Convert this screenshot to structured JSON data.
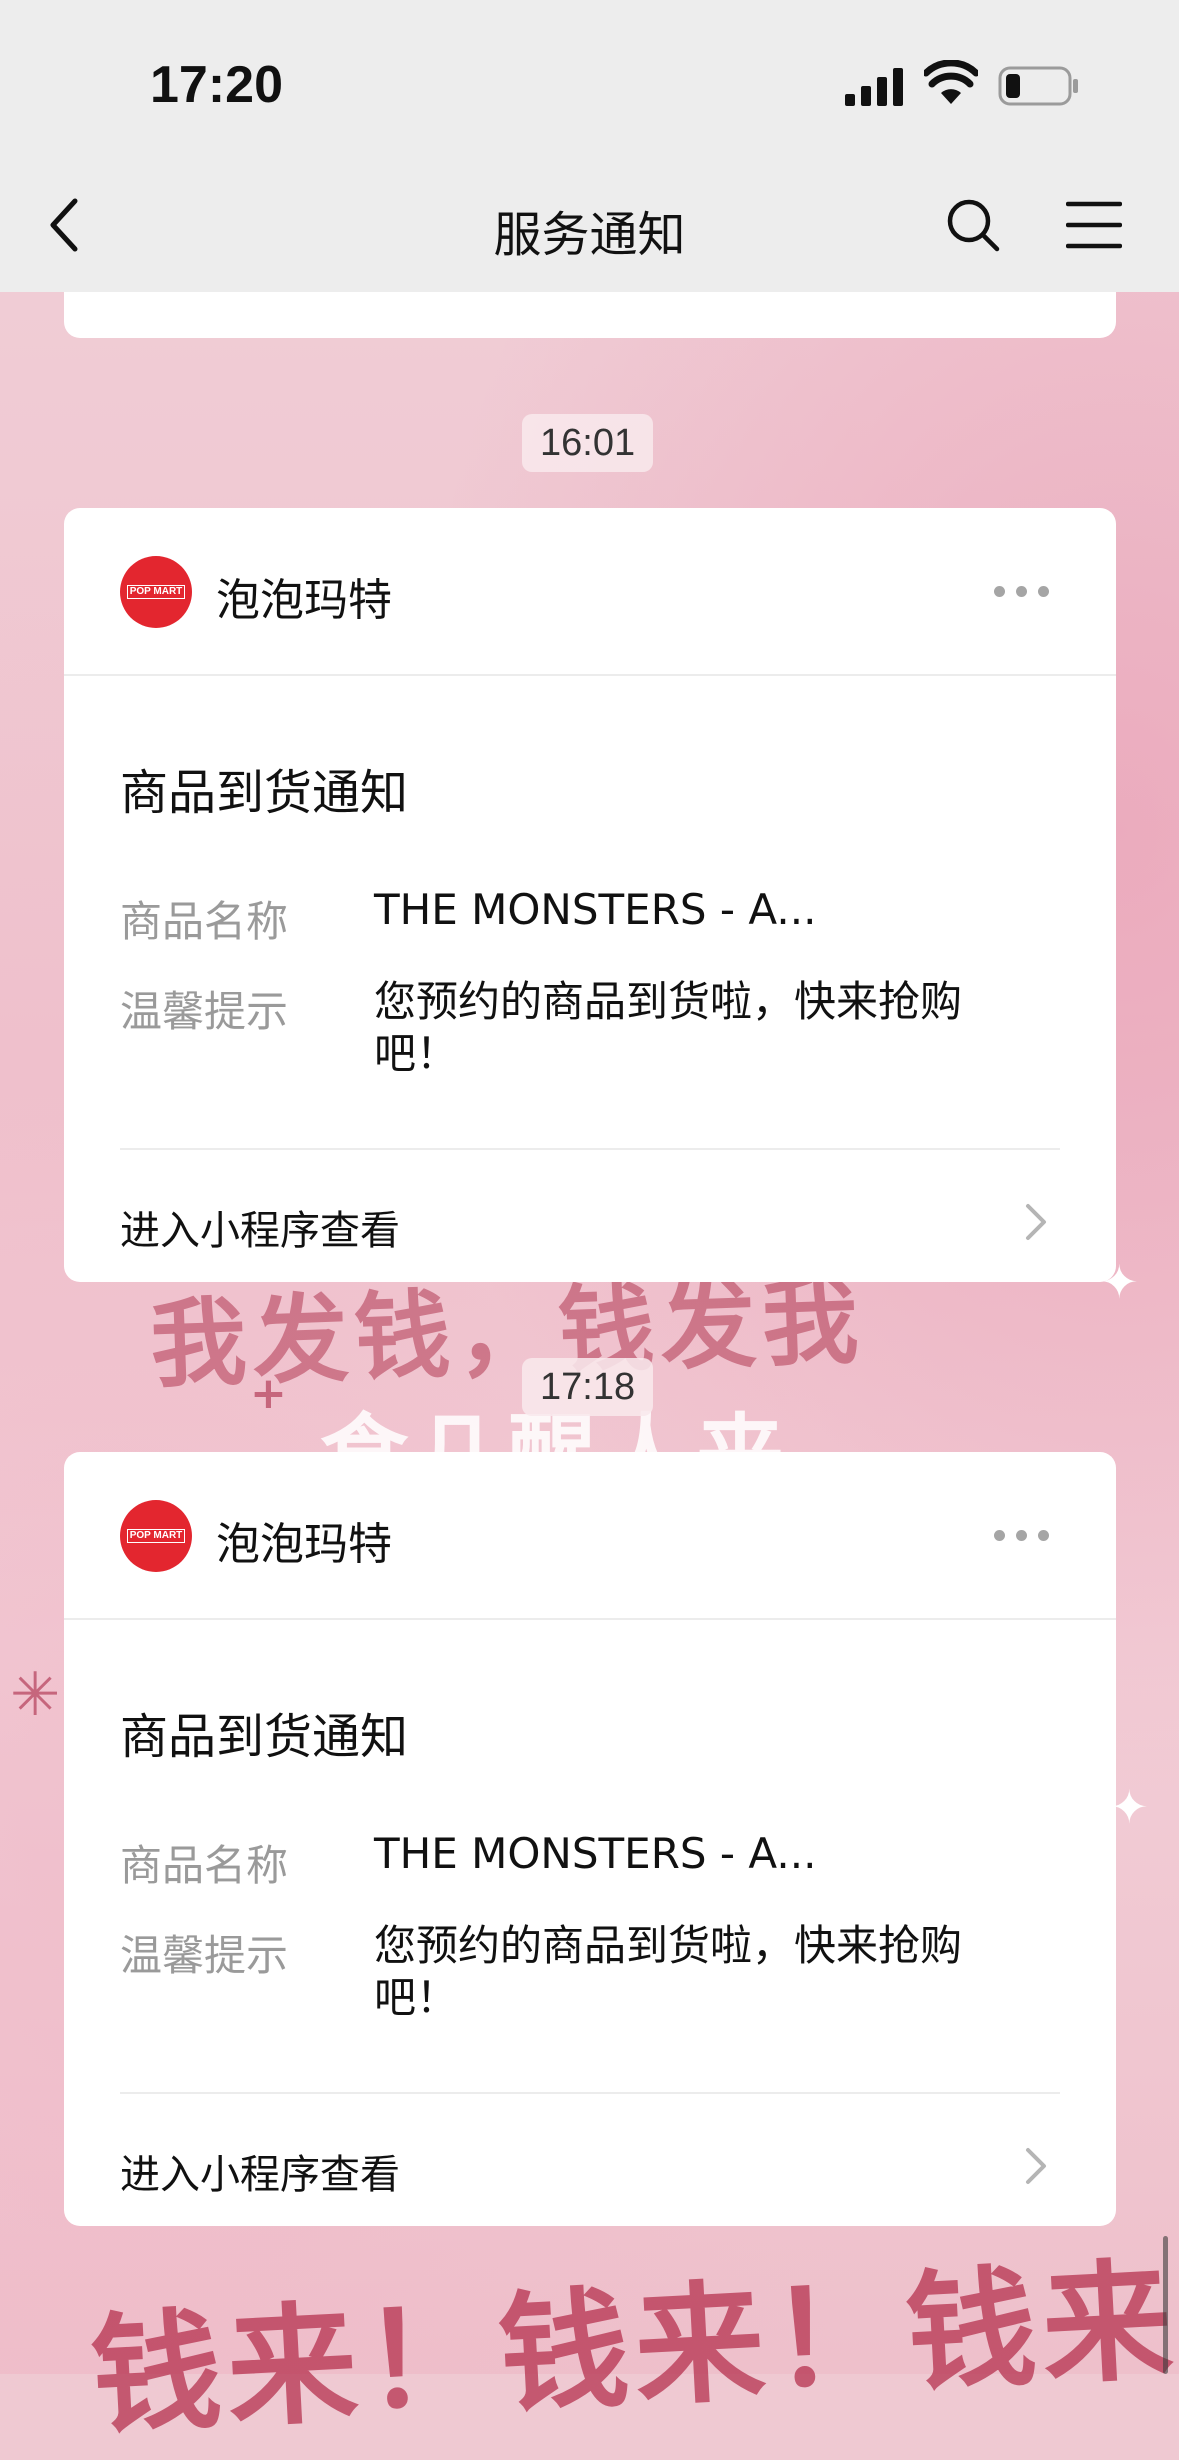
{
  "status_bar": {
    "time": "17:20"
  },
  "nav": {
    "title": "服务通知"
  },
  "background_text": {
    "line1": "我发钱，钱发我",
    "line2": "钱来！钱来！钱来！"
  },
  "notifications": [
    {
      "timestamp": "16:01",
      "brand": "泡泡玛特",
      "logo_text": "POP MART",
      "title": "商品到货通知",
      "fields": [
        {
          "label": "商品名称",
          "value": "THE MONSTERS - A..."
        },
        {
          "label": "温馨提示",
          "value": "您预约的商品到货啦，快来抢购吧！"
        }
      ],
      "link_label": "进入小程序查看"
    },
    {
      "timestamp": "17:18",
      "brand": "泡泡玛特",
      "logo_text": "POP MART",
      "title": "商品到货通知",
      "fields": [
        {
          "label": "商品名称",
          "value": "THE MONSTERS - A..."
        },
        {
          "label": "温馨提示",
          "value": "您预约的商品到货啦，快来抢购吧！"
        }
      ],
      "link_label": "进入小程序查看"
    }
  ],
  "colors": {
    "brand_red": "#e3262f",
    "nav_bg": "#ededed",
    "label_gray": "#9a9a9a"
  },
  "icons": [
    "back-icon",
    "search-icon",
    "menu-icon",
    "more-icon",
    "chevron-right-icon",
    "signal-icon",
    "wifi-icon",
    "battery-icon"
  ]
}
